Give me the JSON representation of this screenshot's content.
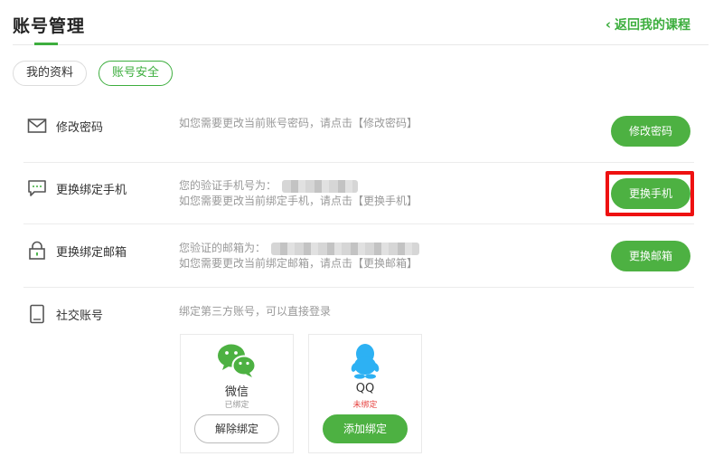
{
  "header": {
    "title": "账号管理",
    "back_label": "返回我的课程"
  },
  "tabs": [
    {
      "label": "我的资料",
      "active": false
    },
    {
      "label": "账号安全",
      "active": true
    }
  ],
  "rows": {
    "password": {
      "label": "修改密码",
      "desc": "如您需要更改当前账号密码，请点击【修改密码】",
      "button": "修改密码"
    },
    "phone": {
      "label": "更换绑定手机",
      "desc_prefix": "您的验证手机号为：",
      "desc": "如您需要更改当前绑定手机，请点击【更换手机】",
      "button": "更换手机"
    },
    "email": {
      "label": "更换绑定邮箱",
      "desc_prefix": "您验证的邮箱为：",
      "desc": "如您需要更改当前绑定邮箱，请点击【更换邮箱】",
      "button": "更换邮箱"
    },
    "social": {
      "label": "社交账号",
      "desc": "绑定第三方账号，可以直接登录"
    }
  },
  "social_accounts": [
    {
      "name": "微信",
      "status": "已绑定",
      "button": "解除绑定",
      "icon": "wechat-icon"
    },
    {
      "name": "QQ",
      "status": "未绑定",
      "button": "添加绑定",
      "icon": "qq-icon"
    }
  ],
  "colors": {
    "accent": "#3dae3e",
    "button": "#4db142",
    "highlight": "#ee1111",
    "qq": "#2db1f3",
    "unbound": "#e64340"
  }
}
